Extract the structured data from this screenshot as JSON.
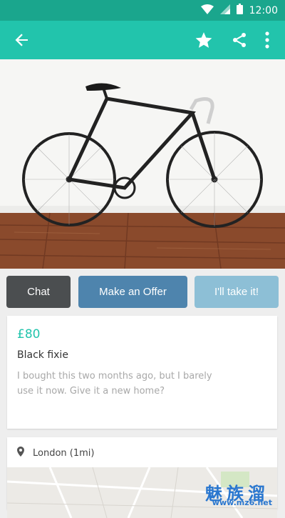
{
  "status": {
    "time": "12:00"
  },
  "actions": {
    "chat": "Chat",
    "offer": "Make an Offer",
    "take": "I'll take it!"
  },
  "listing": {
    "price": "£80",
    "title": "Black fixie",
    "description": "I bought this two months ago, but I barely use it now. Give it a new home?"
  },
  "location": {
    "label": "London (1mi)"
  },
  "watermark": {
    "brand": "魅族溜",
    "url": "www.mz6.net"
  },
  "colors": {
    "status_bar": "#1aa68d",
    "app_bar": "#22c4ac",
    "price": "#22c4ac",
    "chat": "#4b4e50",
    "offer": "#4e84ad",
    "take": "#8dbfd6"
  },
  "icons": [
    "back-arrow-icon",
    "star-icon",
    "share-icon",
    "more-vert-icon",
    "wifi-icon",
    "signal-icon",
    "battery-icon",
    "location-pin-icon"
  ]
}
